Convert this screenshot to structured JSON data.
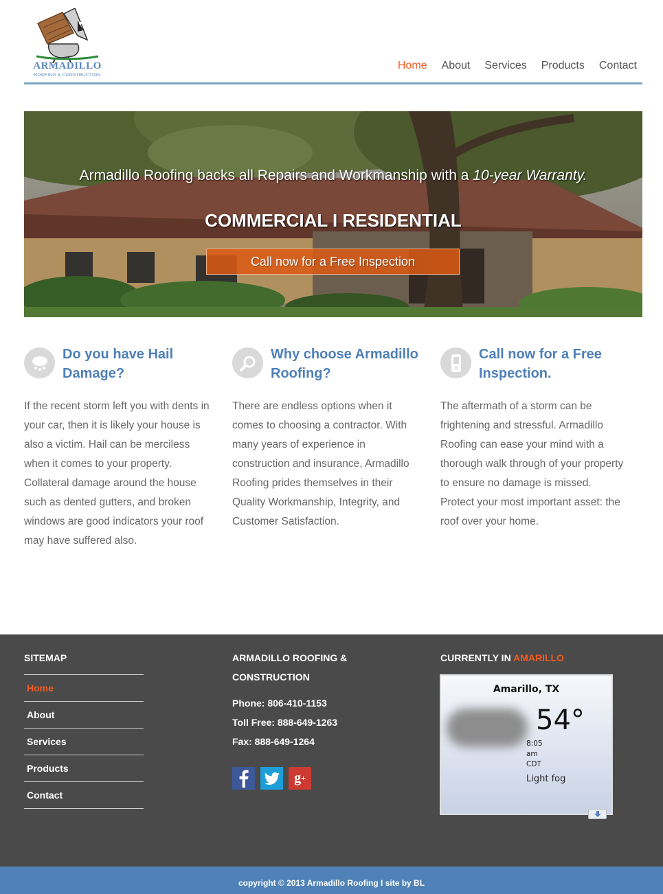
{
  "logo": {
    "name": "ARMADILLO",
    "tagline": "ROOFING & CONSTRUCTION"
  },
  "nav": {
    "items": [
      {
        "label": "Home",
        "active": true
      },
      {
        "label": "About",
        "active": false
      },
      {
        "label": "Services",
        "active": false
      },
      {
        "label": "Products",
        "active": false
      },
      {
        "label": "Contact",
        "active": false
      }
    ]
  },
  "hero": {
    "line1_prefix": "Armadillo Roofing backs all Repairs and Workmanship with a ",
    "line1_emphasis": "10-year Warranty.",
    "line2": "COMMERCIAL I RESIDENTIAL",
    "cta": "Call now for a Free Inspection"
  },
  "features": [
    {
      "icon": "hail-cloud-icon",
      "title": "Do you have Hail Damage?",
      "body": "If the recent storm left you with dents in your car, then it is likely your house is also a victim. Hail can be merciless when it comes to your property. Collateral damage around the house such as dented gutters, and broken windows are good indicators your roof may have suffered also."
    },
    {
      "icon": "magnifier-icon",
      "title": "Why choose Armadillo Roofing?",
      "body": "There are endless options when it comes to choosing a contractor. With many years of experience in construction and insurance, Armadillo Roofing prides themselves in their Quality Workmanship, Integrity, and Customer Satisfaction."
    },
    {
      "icon": "phone-icon",
      "title": "Call now for a Free Inspection.",
      "body": "The aftermath of a storm can be frightening and stressful. Armadillo Roofing can ease your mind with a thorough walk through of your property to ensure no damage is missed. Protect your most important asset: the roof over your home."
    }
  ],
  "footer": {
    "sitemap_heading": "SITEMAP",
    "sitemap": [
      "Home",
      "About",
      "Services",
      "Products",
      "Contact"
    ],
    "company_heading_1": "ARMADILLO ROOFING &",
    "company_heading_2": "CONSTRUCTION",
    "phone": "Phone: 806-410-1153",
    "toll_free": "Toll Free: 888-649-1263",
    "fax": "Fax: 888-649-1264",
    "social": [
      "facebook-icon",
      "twitter-icon",
      "google-plus-icon"
    ],
    "currently_label": "CURRENTLY IN ",
    "currently_city": "AMARILLO",
    "weather": {
      "city": "Amarillo, TX",
      "temp": "54°",
      "time": "8:05 am CDT",
      "condition": "Light fog"
    },
    "copyright": "copyright © 2013 Armadillo Roofing I site by BL"
  },
  "colors": {
    "accent": "#f15a22",
    "brand_blue": "#4f80b8",
    "footer_bg": "#4a4a4a",
    "copyright_bg": "#4f82b6"
  }
}
